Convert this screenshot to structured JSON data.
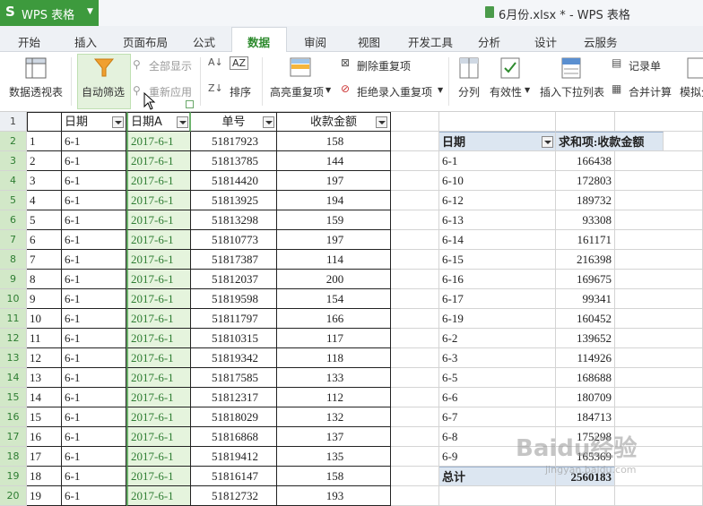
{
  "app": {
    "logo": "S",
    "name": "WPS 表格",
    "caret": "▼"
  },
  "document_title": "6月份.xlsx * - WPS 表格",
  "tabs": [
    "开始",
    "插入",
    "页面布局",
    "公式",
    "数据",
    "审阅",
    "视图",
    "开发工具",
    "分析",
    "设计",
    "云服务"
  ],
  "active_tab": "数据",
  "ribbon": {
    "pivot_table": "数据透视表",
    "auto_filter": "自动筛选",
    "show_all": "全部显示",
    "reapply": "重新应用",
    "sort": "排序",
    "highlight_dup": "高亮重复项",
    "remove_dup": "删除重复项",
    "reject_dup": "拒绝录入重复项",
    "split": "分列",
    "validity": "有效性",
    "insert_dropdown": "插入下拉列表",
    "record_form": "记录单",
    "merge_calc": "合并计算",
    "simulate": "模拟分"
  },
  "columns": {
    "a": "",
    "b": "日期",
    "c": "日期A",
    "d": "单号",
    "e": "收款金额"
  },
  "rows": [
    {
      "n": "2",
      "a": "1",
      "b": "6-1",
      "c": "2017-6-1",
      "d": "51817923",
      "e": "158"
    },
    {
      "n": "3",
      "a": "2",
      "b": "6-1",
      "c": "2017-6-1",
      "d": "51813785",
      "e": "144"
    },
    {
      "n": "4",
      "a": "3",
      "b": "6-1",
      "c": "2017-6-1",
      "d": "51814420",
      "e": "197"
    },
    {
      "n": "5",
      "a": "4",
      "b": "6-1",
      "c": "2017-6-1",
      "d": "51813925",
      "e": "194"
    },
    {
      "n": "6",
      "a": "5",
      "b": "6-1",
      "c": "2017-6-1",
      "d": "51813298",
      "e": "159"
    },
    {
      "n": "7",
      "a": "6",
      "b": "6-1",
      "c": "2017-6-1",
      "d": "51810773",
      "e": "197"
    },
    {
      "n": "8",
      "a": "7",
      "b": "6-1",
      "c": "2017-6-1",
      "d": "51817387",
      "e": "114"
    },
    {
      "n": "9",
      "a": "8",
      "b": "6-1",
      "c": "2017-6-1",
      "d": "51812037",
      "e": "200"
    },
    {
      "n": "10",
      "a": "9",
      "b": "6-1",
      "c": "2017-6-1",
      "d": "51819598",
      "e": "154"
    },
    {
      "n": "11",
      "a": "10",
      "b": "6-1",
      "c": "2017-6-1",
      "d": "51811797",
      "e": "166"
    },
    {
      "n": "12",
      "a": "11",
      "b": "6-1",
      "c": "2017-6-1",
      "d": "51810315",
      "e": "117"
    },
    {
      "n": "13",
      "a": "12",
      "b": "6-1",
      "c": "2017-6-1",
      "d": "51819342",
      "e": "118"
    },
    {
      "n": "14",
      "a": "13",
      "b": "6-1",
      "c": "2017-6-1",
      "d": "51817585",
      "e": "133"
    },
    {
      "n": "15",
      "a": "14",
      "b": "6-1",
      "c": "2017-6-1",
      "d": "51812317",
      "e": "112"
    },
    {
      "n": "16",
      "a": "15",
      "b": "6-1",
      "c": "2017-6-1",
      "d": "51818029",
      "e": "132"
    },
    {
      "n": "17",
      "a": "16",
      "b": "6-1",
      "c": "2017-6-1",
      "d": "51816868",
      "e": "137"
    },
    {
      "n": "18",
      "a": "17",
      "b": "6-1",
      "c": "2017-6-1",
      "d": "51819412",
      "e": "135"
    },
    {
      "n": "19",
      "a": "18",
      "b": "6-1",
      "c": "2017-6-1",
      "d": "51816147",
      "e": "158"
    },
    {
      "n": "20",
      "a": "19",
      "b": "6-1",
      "c": "2017-6-1",
      "d": "51812732",
      "e": "193"
    }
  ],
  "header_row_number": "1",
  "pivot": {
    "header_label": "日期",
    "header_value": "求和项:收款金额",
    "items": [
      {
        "label": "6-1",
        "value": "166438"
      },
      {
        "label": "6-10",
        "value": "172803"
      },
      {
        "label": "6-12",
        "value": "189732"
      },
      {
        "label": "6-13",
        "value": "93308"
      },
      {
        "label": "6-14",
        "value": "161171"
      },
      {
        "label": "6-15",
        "value": "216398"
      },
      {
        "label": "6-16",
        "value": "169675"
      },
      {
        "label": "6-17",
        "value": "99341"
      },
      {
        "label": "6-19",
        "value": "160452"
      },
      {
        "label": "6-2",
        "value": "139652"
      },
      {
        "label": "6-3",
        "value": "114926"
      },
      {
        "label": "6-5",
        "value": "168688"
      },
      {
        "label": "6-6",
        "value": "180709"
      },
      {
        "label": "6-7",
        "value": "184713"
      },
      {
        "label": "6-8",
        "value": "175298"
      },
      {
        "label": "6-9",
        "value": "165369"
      }
    ],
    "total_label": "总计",
    "total_value": "2560183"
  },
  "watermark": "Baidu经验",
  "watermark_sub": "jingyan.baidu.com",
  "colors": {
    "accent": "#3d9a3d",
    "selected_col": "#e5f4dd",
    "pivot_header": "#dce6f1"
  }
}
